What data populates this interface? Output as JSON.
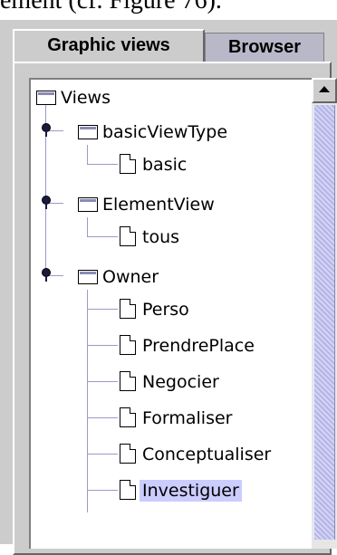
{
  "caption": "ement (cf. Figure 76).",
  "tabs": [
    {
      "label": "Graphic views",
      "active": true
    },
    {
      "label": "Browser",
      "active": false
    }
  ],
  "tree": {
    "root": "Views",
    "groups": [
      {
        "label": "basicViewType",
        "children": [
          "basic"
        ]
      },
      {
        "label": "ElementView",
        "children": [
          "tous"
        ]
      },
      {
        "label": "Owner",
        "children": [
          "Perso",
          "PrendrePlace",
          "Negocier",
          "Formaliser",
          "Conceptualiser",
          "Investiguer"
        ]
      }
    ],
    "selected": "Investiguer"
  },
  "colors": {
    "selection": "#ccccff",
    "scroll_thumb": "#c8c8f0",
    "panel": "#cccccc"
  }
}
